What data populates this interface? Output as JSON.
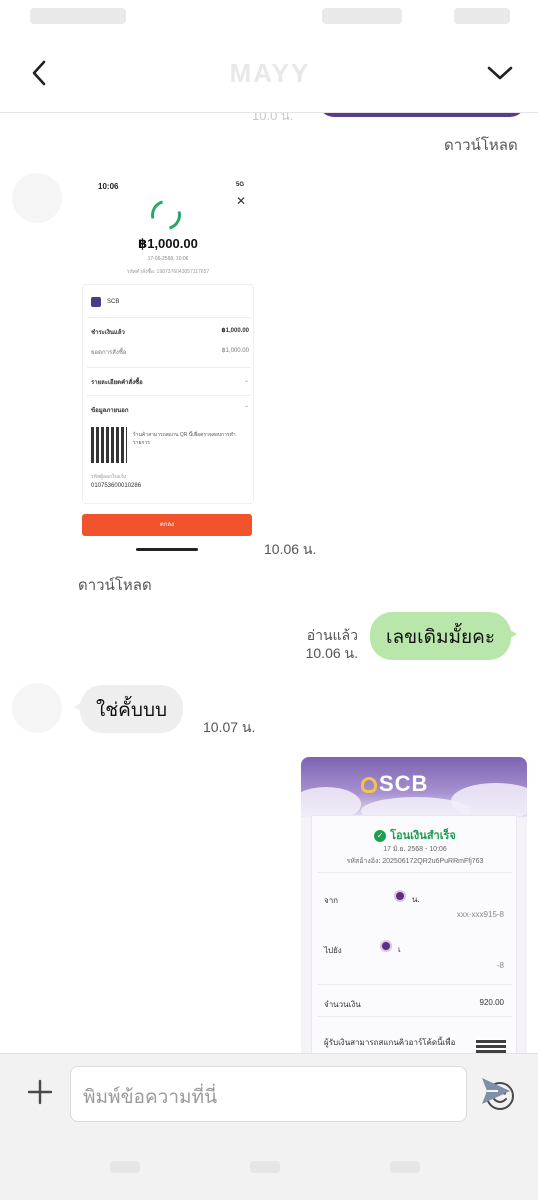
{
  "header": {
    "title": "MAYY"
  },
  "messages": {
    "download_1": "ดาวน์โหลด",
    "image1": {
      "phone_time": "10:06",
      "phone_signal": "5G",
      "amount": "฿1,000.00",
      "date": "17-06-2568, 10:06",
      "reference": "รหัสคำสั่งซื้อ: 1987376043057117657",
      "bank": "SCB",
      "paid_label": "ชำระเงินแล้ว",
      "paid_value": "฿1,000.00",
      "order_total_label": "ยอดการสั่งซื้อ",
      "order_total_value": "฿1,000.00",
      "order_detail_label": "รายละเอียดคำสั่งซื้อ",
      "extra_info_label": "ข้อมูลภายนอก",
      "qr_text": "ร้านค้าสามารถสแกน QR นี้เพื่อตรวจสอบการทำรายการ",
      "merchant_id_label": "รหัสผู้ออกใบแจ้ง",
      "merchant_id": "010753600010286",
      "button_label": "ตกลง"
    },
    "image1_time": "10.06 น.",
    "download_2": "ดาวน์โหลด",
    "outgoing_1": {
      "text": "เลขเดิมมั้ยคะ",
      "read_status": "อ่านแล้ว",
      "time": "10.06 น."
    },
    "incoming_1": {
      "text": "ใช่คั้บบบ",
      "time": "10.07 น."
    },
    "image2": {
      "brand": "SCB",
      "success_title": "โอนเงินสำเร็จ",
      "date": "17 มิ.ย. 2568 - 10:06",
      "reference": "รหัสอ้างอิง: 202506172QR2u6PuRRmFfj763",
      "from_label": "จาก",
      "from_name": "น.",
      "from_account": "xxx-xxx915-8",
      "to_label": "ไปยัง",
      "to_name": "เ",
      "to_account": "-8",
      "amount_label": "จำนวนเงิน",
      "amount_value": "920.00",
      "qr_note": "ผู้รับเงินสามารถสแกนคิวอาร์โค้ดนี้เพื่อ"
    }
  },
  "composer": {
    "placeholder": "พิมพ์ข้อความที่นี่"
  },
  "colors": {
    "outgoing_bubble": "#b9e6aa",
    "incoming_bubble": "#eeeeee",
    "scb_purple": "#5b2f86",
    "success_green": "#1b9e50",
    "confirm_orange": "#f0522b",
    "send_icon": "#7f8fa6"
  },
  "icons": {
    "back": "chevron-left-icon",
    "collapse": "chevron-down-icon",
    "add": "plus-icon",
    "emoji": "smiley-icon",
    "send": "send-arrow-icon"
  }
}
